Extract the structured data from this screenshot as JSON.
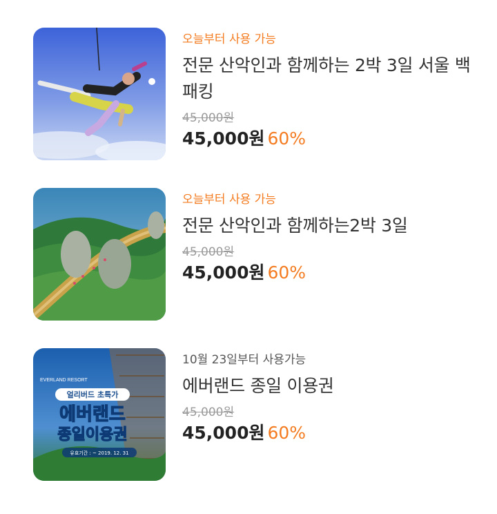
{
  "products": [
    {
      "availability": "오늘부터 사용 가능",
      "title": "전문 산악인과 함께하는 2박 3일 서울 백패킹",
      "original_price": "45,000원",
      "price": "45,000원",
      "discount": "60%"
    },
    {
      "availability": "오늘부터 사용 가능",
      "title": "전문 산악인과 함께하는2박 3일",
      "original_price": "45,000원",
      "price": "45,000원",
      "discount": "60%"
    },
    {
      "availability": "10월 23일부터 사용가능",
      "title": "에버랜드 종일 이용권",
      "original_price": "45,000원",
      "price": "45,000원",
      "discount": "60%",
      "poster": {
        "brand": "EVERLAND RESORT",
        "ribbon": "얼리버드 초특가",
        "headline_1": "에버랜드",
        "headline_2": "종일이용권",
        "period": "유효기간 : ~ 2019. 12. 31"
      }
    }
  ],
  "colors": {
    "accent": "#f47b20",
    "title": "#333333",
    "strike": "#9a9a9a",
    "price": "#222222"
  }
}
